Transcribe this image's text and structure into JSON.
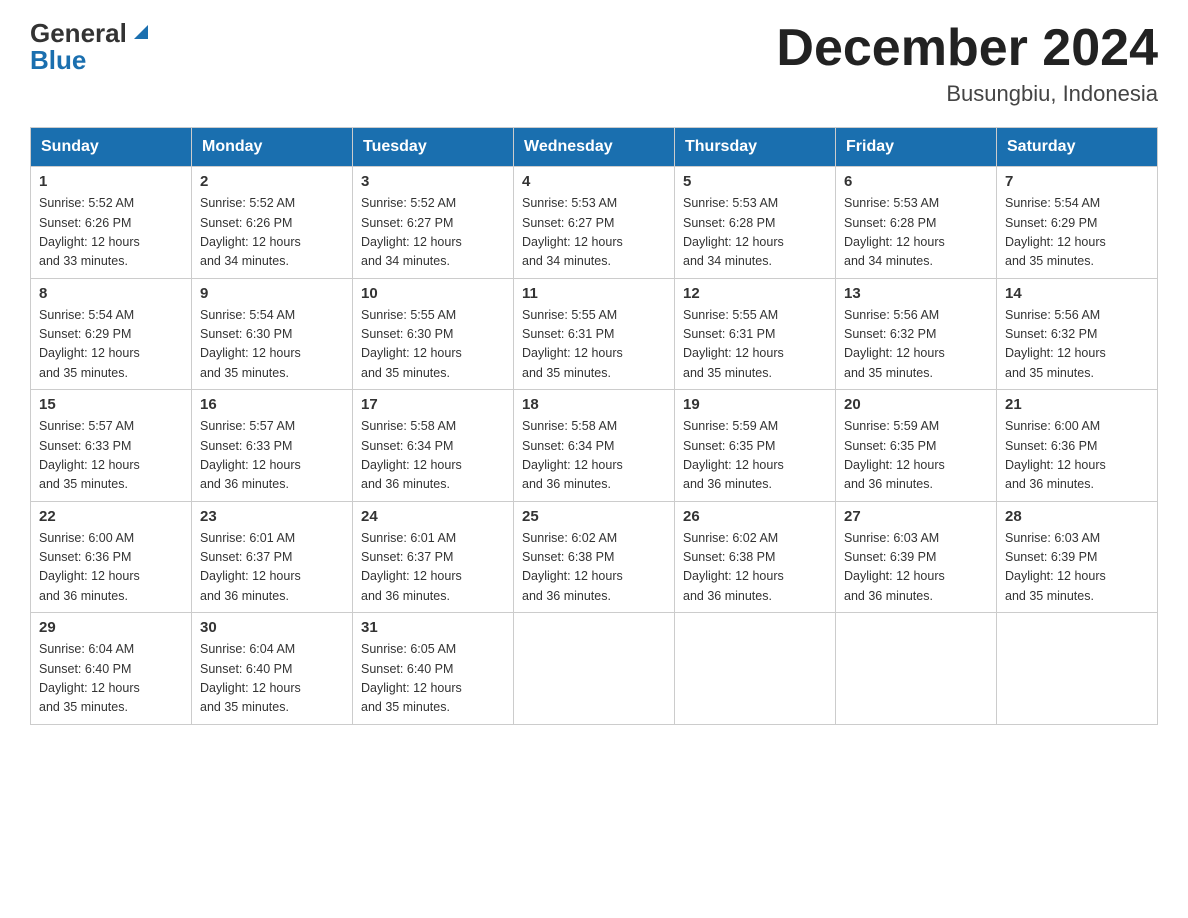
{
  "header": {
    "logo_general": "General",
    "logo_blue": "Blue",
    "title": "December 2024",
    "location": "Busungbiu, Indonesia"
  },
  "calendar": {
    "days_of_week": [
      "Sunday",
      "Monday",
      "Tuesday",
      "Wednesday",
      "Thursday",
      "Friday",
      "Saturday"
    ],
    "weeks": [
      [
        {
          "day": "1",
          "sunrise": "5:52 AM",
          "sunset": "6:26 PM",
          "daylight": "12 hours and 33 minutes."
        },
        {
          "day": "2",
          "sunrise": "5:52 AM",
          "sunset": "6:26 PM",
          "daylight": "12 hours and 34 minutes."
        },
        {
          "day": "3",
          "sunrise": "5:52 AM",
          "sunset": "6:27 PM",
          "daylight": "12 hours and 34 minutes."
        },
        {
          "day": "4",
          "sunrise": "5:53 AM",
          "sunset": "6:27 PM",
          "daylight": "12 hours and 34 minutes."
        },
        {
          "day": "5",
          "sunrise": "5:53 AM",
          "sunset": "6:28 PM",
          "daylight": "12 hours and 34 minutes."
        },
        {
          "day": "6",
          "sunrise": "5:53 AM",
          "sunset": "6:28 PM",
          "daylight": "12 hours and 34 minutes."
        },
        {
          "day": "7",
          "sunrise": "5:54 AM",
          "sunset": "6:29 PM",
          "daylight": "12 hours and 35 minutes."
        }
      ],
      [
        {
          "day": "8",
          "sunrise": "5:54 AM",
          "sunset": "6:29 PM",
          "daylight": "12 hours and 35 minutes."
        },
        {
          "day": "9",
          "sunrise": "5:54 AM",
          "sunset": "6:30 PM",
          "daylight": "12 hours and 35 minutes."
        },
        {
          "day": "10",
          "sunrise": "5:55 AM",
          "sunset": "6:30 PM",
          "daylight": "12 hours and 35 minutes."
        },
        {
          "day": "11",
          "sunrise": "5:55 AM",
          "sunset": "6:31 PM",
          "daylight": "12 hours and 35 minutes."
        },
        {
          "day": "12",
          "sunrise": "5:55 AM",
          "sunset": "6:31 PM",
          "daylight": "12 hours and 35 minutes."
        },
        {
          "day": "13",
          "sunrise": "5:56 AM",
          "sunset": "6:32 PM",
          "daylight": "12 hours and 35 minutes."
        },
        {
          "day": "14",
          "sunrise": "5:56 AM",
          "sunset": "6:32 PM",
          "daylight": "12 hours and 35 minutes."
        }
      ],
      [
        {
          "day": "15",
          "sunrise": "5:57 AM",
          "sunset": "6:33 PM",
          "daylight": "12 hours and 35 minutes."
        },
        {
          "day": "16",
          "sunrise": "5:57 AM",
          "sunset": "6:33 PM",
          "daylight": "12 hours and 36 minutes."
        },
        {
          "day": "17",
          "sunrise": "5:58 AM",
          "sunset": "6:34 PM",
          "daylight": "12 hours and 36 minutes."
        },
        {
          "day": "18",
          "sunrise": "5:58 AM",
          "sunset": "6:34 PM",
          "daylight": "12 hours and 36 minutes."
        },
        {
          "day": "19",
          "sunrise": "5:59 AM",
          "sunset": "6:35 PM",
          "daylight": "12 hours and 36 minutes."
        },
        {
          "day": "20",
          "sunrise": "5:59 AM",
          "sunset": "6:35 PM",
          "daylight": "12 hours and 36 minutes."
        },
        {
          "day": "21",
          "sunrise": "6:00 AM",
          "sunset": "6:36 PM",
          "daylight": "12 hours and 36 minutes."
        }
      ],
      [
        {
          "day": "22",
          "sunrise": "6:00 AM",
          "sunset": "6:36 PM",
          "daylight": "12 hours and 36 minutes."
        },
        {
          "day": "23",
          "sunrise": "6:01 AM",
          "sunset": "6:37 PM",
          "daylight": "12 hours and 36 minutes."
        },
        {
          "day": "24",
          "sunrise": "6:01 AM",
          "sunset": "6:37 PM",
          "daylight": "12 hours and 36 minutes."
        },
        {
          "day": "25",
          "sunrise": "6:02 AM",
          "sunset": "6:38 PM",
          "daylight": "12 hours and 36 minutes."
        },
        {
          "day": "26",
          "sunrise": "6:02 AM",
          "sunset": "6:38 PM",
          "daylight": "12 hours and 36 minutes."
        },
        {
          "day": "27",
          "sunrise": "6:03 AM",
          "sunset": "6:39 PM",
          "daylight": "12 hours and 36 minutes."
        },
        {
          "day": "28",
          "sunrise": "6:03 AM",
          "sunset": "6:39 PM",
          "daylight": "12 hours and 35 minutes."
        }
      ],
      [
        {
          "day": "29",
          "sunrise": "6:04 AM",
          "sunset": "6:40 PM",
          "daylight": "12 hours and 35 minutes."
        },
        {
          "day": "30",
          "sunrise": "6:04 AM",
          "sunset": "6:40 PM",
          "daylight": "12 hours and 35 minutes."
        },
        {
          "day": "31",
          "sunrise": "6:05 AM",
          "sunset": "6:40 PM",
          "daylight": "12 hours and 35 minutes."
        },
        null,
        null,
        null,
        null
      ]
    ],
    "sunrise_label": "Sunrise:",
    "sunset_label": "Sunset:",
    "daylight_label": "Daylight:"
  }
}
